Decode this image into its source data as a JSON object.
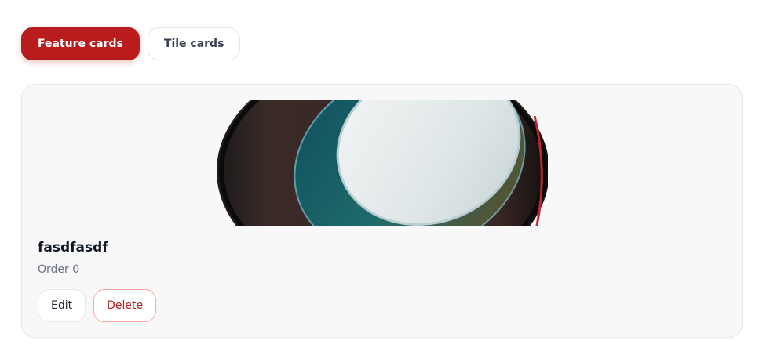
{
  "header": {
    "subtitle": ""
  },
  "tabs": [
    {
      "label": "Feature cards",
      "active": true
    },
    {
      "label": "Tile cards",
      "active": false
    }
  ],
  "card": {
    "title": "fasdfasdf",
    "order_text": "Order 0",
    "image_alt": "glass-disc-image",
    "actions": {
      "edit_label": "Edit",
      "delete_label": "Delete"
    }
  },
  "colors": {
    "accent": "#b91c1c",
    "delete_border": "#fca5a5",
    "card_bg": "#f8f8f8"
  }
}
